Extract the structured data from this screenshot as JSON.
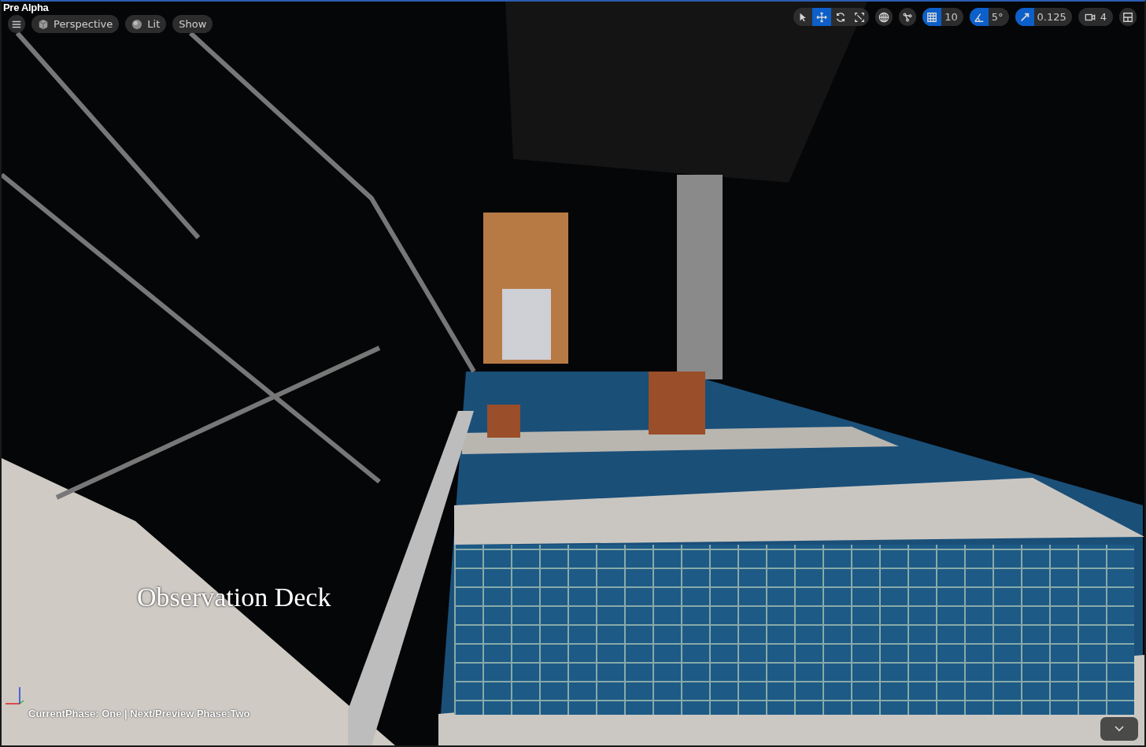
{
  "title": "Pre Alpha",
  "left_toolbar": {
    "view_mode": "Perspective",
    "lighting": "Lit",
    "show": "Show"
  },
  "transform_tools": [
    {
      "kind": "select",
      "selected": false
    },
    {
      "kind": "translate",
      "selected": true
    },
    {
      "kind": "rotate",
      "selected": false
    },
    {
      "kind": "scale",
      "selected": false
    }
  ],
  "snaps": [
    {
      "kind": "grid",
      "on": true,
      "value": "10"
    },
    {
      "kind": "angle",
      "on": true,
      "value": "5°"
    },
    {
      "kind": "scale",
      "on": true,
      "value": "0.125"
    }
  ],
  "camera_speed": "4",
  "scene_label": "Observation Deck",
  "phase_text": "CurrentPhase: One | Next/Preview Phase:Two"
}
